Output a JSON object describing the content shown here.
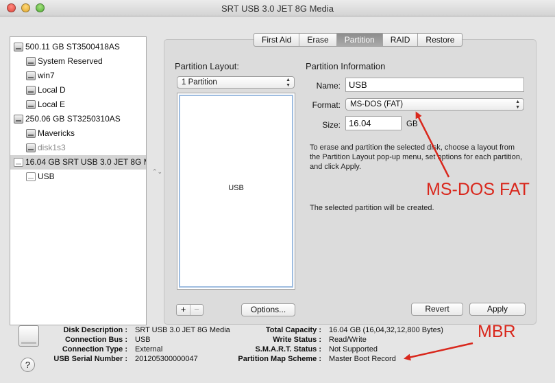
{
  "window": {
    "title": "SRT USB 3.0 JET 8G Media"
  },
  "sidebar": {
    "items": [
      {
        "label": "500.11 GB ST3500418AS",
        "kind": "disk",
        "level": 0,
        "selected": false,
        "dimmed": false
      },
      {
        "label": "System Reserved",
        "kind": "volume",
        "level": 1,
        "selected": false,
        "dimmed": false
      },
      {
        "label": "win7",
        "kind": "volume",
        "level": 1,
        "selected": false,
        "dimmed": false
      },
      {
        "label": "Local D",
        "kind": "volume",
        "level": 1,
        "selected": false,
        "dimmed": false
      },
      {
        "label": "Local E",
        "kind": "volume",
        "level": 1,
        "selected": false,
        "dimmed": false
      },
      {
        "label": "250.06 GB ST3250310AS",
        "kind": "disk",
        "level": 0,
        "selected": false,
        "dimmed": false
      },
      {
        "label": "Mavericks",
        "kind": "volume",
        "level": 1,
        "selected": false,
        "dimmed": false
      },
      {
        "label": "disk1s3",
        "kind": "volume",
        "level": 1,
        "selected": false,
        "dimmed": true
      },
      {
        "label": "16.04 GB SRT USB 3.0 JET 8G M",
        "kind": "usb-disk",
        "level": 0,
        "selected": true,
        "dimmed": false
      },
      {
        "label": "USB",
        "kind": "usb-volume",
        "level": 1,
        "selected": false,
        "dimmed": false
      }
    ]
  },
  "tabs": [
    {
      "label": "First Aid",
      "active": false
    },
    {
      "label": "Erase",
      "active": false
    },
    {
      "label": "Partition",
      "active": true
    },
    {
      "label": "RAID",
      "active": false
    },
    {
      "label": "Restore",
      "active": false
    }
  ],
  "partition": {
    "layout_heading": "Partition Layout:",
    "layout_value": "1 Partition",
    "partition_block_label": "USB",
    "plus_label": "+",
    "minus_label": "−",
    "options_label": "Options...",
    "info_heading": "Partition Information",
    "name_label": "Name:",
    "name_value": "USB",
    "format_label": "Format:",
    "format_value": "MS-DOS (FAT)",
    "size_label": "Size:",
    "size_value": "16.04",
    "size_unit": "GB",
    "instructions": "To erase and partition the selected disk, choose a layout from the Partition Layout pop-up menu, set options for each partition, and click Apply.",
    "status": "The selected partition will be created.",
    "revert_label": "Revert",
    "apply_label": "Apply"
  },
  "disk_info": {
    "left": [
      {
        "label": "Disk Description :",
        "value": "SRT USB 3.0 JET 8G Media"
      },
      {
        "label": "Connection Bus :",
        "value": "USB"
      },
      {
        "label": "Connection Type :",
        "value": "External"
      },
      {
        "label": "USB Serial Number :",
        "value": "201205300000047"
      }
    ],
    "right": [
      {
        "label": "Total Capacity :",
        "value": "16.04 GB (16,04,32,12,800 Bytes)"
      },
      {
        "label": "Write Status :",
        "value": "Read/Write"
      },
      {
        "label": "S.M.A.R.T. Status :",
        "value": "Not Supported"
      },
      {
        "label": "Partition Map Scheme :",
        "value": "Master Boot Record"
      }
    ]
  },
  "help_label": "?",
  "annotations": {
    "format_note": "MS-DOS FAT",
    "scheme_note": "MBR",
    "color": "#d9271c"
  },
  "colors": {
    "selection": "#d4d4d4",
    "partition_border": "#9fbde0",
    "active_tab": "#999999"
  }
}
